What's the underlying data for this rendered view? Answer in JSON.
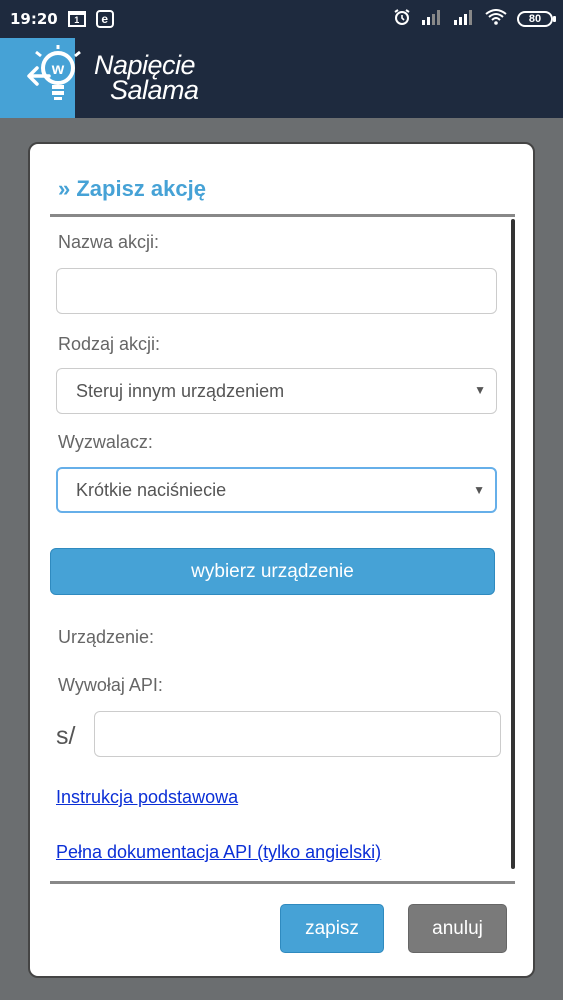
{
  "status": {
    "time": "19:20",
    "calendar_day": "1",
    "battery": "80"
  },
  "app": {
    "logo_line1": "Napięcie",
    "logo_line2": "Salama"
  },
  "dialog": {
    "title": "» Zapisz akcję",
    "action_name_label": "Nazwa akcji:",
    "action_name_value": "",
    "action_type_label": "Rodzaj akcji:",
    "action_type_value": "Steruj innym urządzeniem",
    "trigger_label": "Wyzwalacz:",
    "trigger_value": "Krótkie naciśniecie",
    "choose_device_button": "wybierz urządzenie",
    "device_label": "Urządzenie:",
    "api_label": "Wywołaj API:",
    "api_prefix": "s/",
    "api_value": "",
    "link_basic": "Instrukcja podstawowa",
    "link_full_docs": "Pełna dokumentacja API (tylko angielski)",
    "save_button": "zapisz",
    "cancel_button": "anuluj"
  },
  "colors": {
    "accent": "#46a2d6",
    "header_bg": "#1e2a3e",
    "overlay": "#6b6e70",
    "link": "#0b2fd6"
  }
}
